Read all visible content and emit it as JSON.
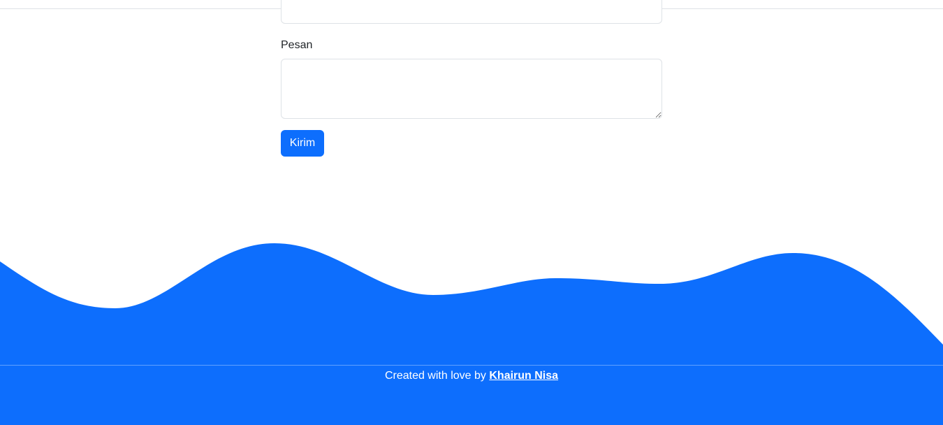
{
  "form": {
    "previous_field_value": "",
    "message_label": "Pesan",
    "message_value": "",
    "submit_label": "Kirim"
  },
  "footer": {
    "prefix": "Created with love by",
    "author": "Khairun Nisa"
  },
  "colors": {
    "primary": "#0d6efd",
    "border": "#dee2e6",
    "text": "#212529",
    "background": "#ffffff"
  }
}
